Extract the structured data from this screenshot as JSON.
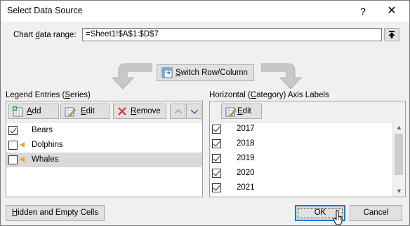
{
  "window": {
    "title": "Select Data Source",
    "help_label": "?",
    "close_label": "✕"
  },
  "range": {
    "label": "Chart data range:",
    "value": "=Sheet1!$A$1:$D$7"
  },
  "switch_button": {
    "label": "Switch Row/Column"
  },
  "legend": {
    "title": "Legend Entries (Series)",
    "add_label": "Add",
    "edit_label": "Edit",
    "remove_label": "Remove",
    "up_label": "▲",
    "down_label": "▼",
    "items": [
      {
        "label": "Bears",
        "checked": true,
        "selected": false
      },
      {
        "label": "Dolphins",
        "checked": false,
        "selected": false
      },
      {
        "label": "Whales",
        "checked": false,
        "selected": true
      }
    ]
  },
  "axis": {
    "title": "Horizontal (Category) Axis Labels",
    "edit_label": "Edit",
    "items": [
      {
        "label": "2017",
        "checked": true
      },
      {
        "label": "2018",
        "checked": true
      },
      {
        "label": "2019",
        "checked": true
      },
      {
        "label": "2020",
        "checked": true
      },
      {
        "label": "2021",
        "checked": true
      }
    ]
  },
  "footer": {
    "hidden_cells_label": "Hidden and Empty Cells",
    "ok_label": "OK",
    "cancel_label": "Cancel"
  },
  "colors": {
    "accent": "#0078d7",
    "series_flag": "#f0a030",
    "remove_icon": "#d03030"
  }
}
